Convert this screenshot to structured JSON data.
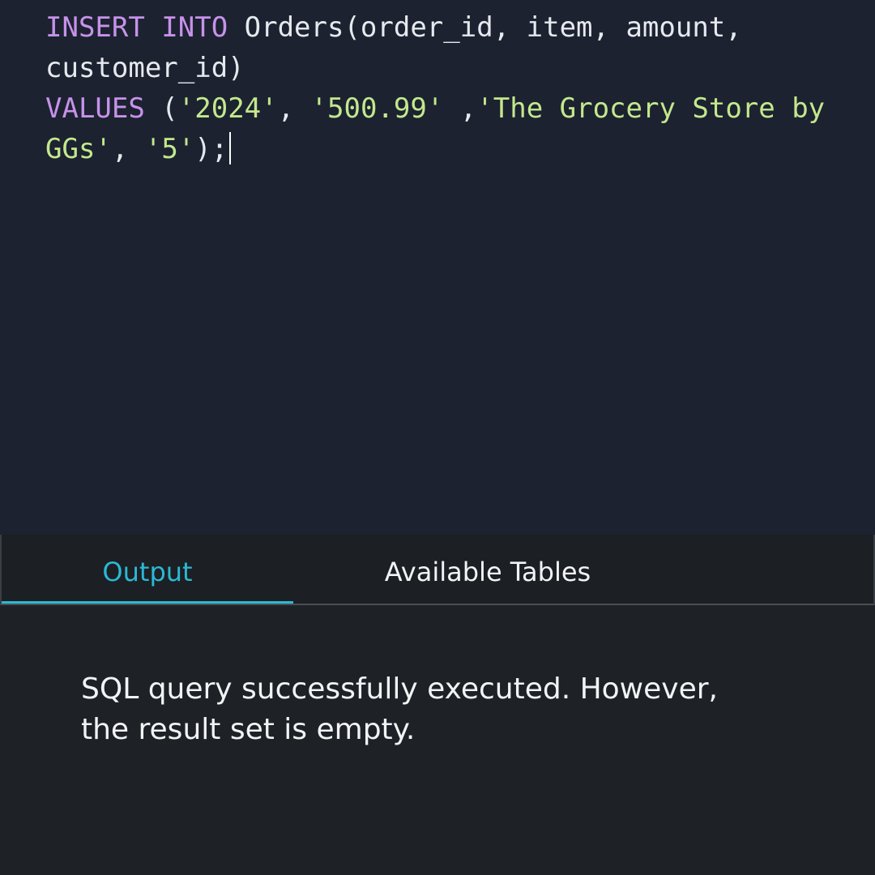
{
  "editor": {
    "lines": [
      [
        {
          "text": "INSERT INTO",
          "type": "kw"
        },
        {
          "text": " Orders(order_id, item, amount,",
          "type": "plain"
        }
      ],
      [
        {
          "text": "customer_id)",
          "type": "plain"
        }
      ],
      [
        {
          "text": "VALUES",
          "type": "kw"
        },
        {
          "text": " (",
          "type": "plain"
        },
        {
          "text": "'2024'",
          "type": "str"
        },
        {
          "text": ", ",
          "type": "plain"
        },
        {
          "text": "'500.99'",
          "type": "str"
        },
        {
          "text": " ,",
          "type": "plain"
        },
        {
          "text": "'The Grocery Store by",
          "type": "str"
        }
      ],
      [
        {
          "text": "GGs'",
          "type": "str"
        },
        {
          "text": ", ",
          "type": "plain"
        },
        {
          "text": "'5'",
          "type": "str"
        },
        {
          "text": ");",
          "type": "plain"
        }
      ]
    ]
  },
  "tabs": {
    "output_label": "Output",
    "tables_label": "Available Tables",
    "active": "Output"
  },
  "output": {
    "message_line1": "SQL query successfully executed. However,",
    "message_line2": "the result set is empty."
  },
  "colors": {
    "keyword": "#c792ea",
    "string": "#c3e88d",
    "accent": "#2bb8d4"
  }
}
